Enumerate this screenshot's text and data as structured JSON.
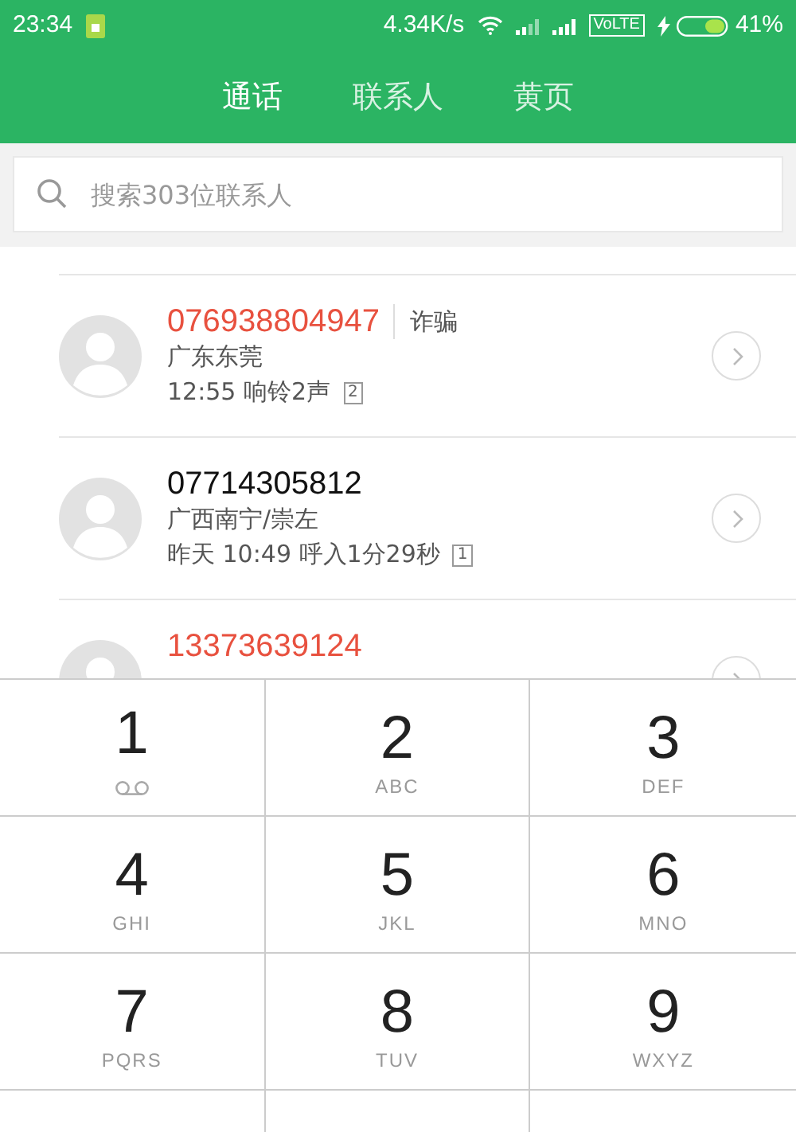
{
  "status_bar": {
    "time": "23:34",
    "speed": "4.34K/s",
    "network": "VoLTE",
    "battery": "41%"
  },
  "tabs": [
    {
      "label": "通话",
      "selected": true
    },
    {
      "label": "联系人",
      "selected": false
    },
    {
      "label": "黄页",
      "selected": false
    }
  ],
  "search": {
    "placeholder": "搜索303位联系人"
  },
  "calls": [
    {
      "number": "076938804947",
      "missed": true,
      "tag": "诈骗",
      "location": "广东东莞",
      "detail": "12:55 响铃2声",
      "count": "2"
    },
    {
      "number": "07714305812",
      "missed": false,
      "location": "广西南宁/崇左",
      "detail": "昨天 10:49 呼入1分29秒",
      "count": "1"
    },
    {
      "number": "13373639124",
      "missed": true
    }
  ],
  "keypad": [
    {
      "digit": "1",
      "kind": "voicemail"
    },
    {
      "digit": "2",
      "letters": "ABC",
      "kind": "letters"
    },
    {
      "digit": "3",
      "letters": "DEF",
      "kind": "letters"
    },
    {
      "digit": "4",
      "letters": "GHI",
      "kind": "letters"
    },
    {
      "digit": "5",
      "letters": "JKL",
      "kind": "letters"
    },
    {
      "digit": "6",
      "letters": "MNO",
      "kind": "letters"
    },
    {
      "digit": "7",
      "letters": "PQRS",
      "kind": "letters"
    },
    {
      "digit": "8",
      "letters": "TUV",
      "kind": "letters"
    },
    {
      "digit": "9",
      "letters": "WXYZ",
      "kind": "letters"
    }
  ]
}
